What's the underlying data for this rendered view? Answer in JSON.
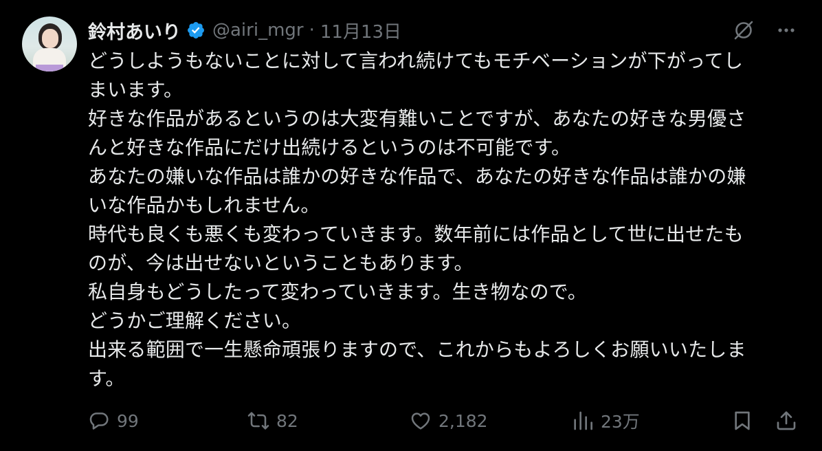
{
  "user": {
    "name": "鈴村あいり",
    "handle": "@airi_mgr",
    "separator": "·",
    "date": "11月13日"
  },
  "tweet": {
    "lines": [
      "どうしようもないことに対して言われ続けてもモチベーションが下がってし",
      "まいます。",
      "好きな作品があるというのは大変有難いことですが、あなたの好きな男優さ",
      "んと好きな作品にだけ出続けるというのは不可能です。",
      "あなたの嫌いな作品は誰かの好きな作品で、あなたの好きな作品は誰かの嫌",
      "いな作品かもしれません。",
      "時代も良くも悪くも変わっていきます。数年前には作品として世に出せたも",
      "のが、今は出せないということもあります。",
      "私自身もどうしたって変わっていきます。生き物なので。",
      "どうかご理解ください。",
      "出来る範囲で一生懸命頑張りますので、これからもよろしくお願いいたしま",
      "す。"
    ]
  },
  "stats": {
    "replies": "99",
    "reposts": "82",
    "likes": "2,182",
    "views": "23万"
  },
  "icons": {
    "verified": "verified-badge-icon",
    "grok": "grok-icon",
    "more": "more-icon",
    "reply": "reply-icon",
    "repost": "repost-icon",
    "like": "heart-icon",
    "views": "views-icon",
    "bookmark": "bookmark-icon",
    "share": "share-icon"
  },
  "colors": {
    "background": "#000000",
    "text": "#e7e9ea",
    "muted": "#71767b",
    "verified": "#1d9bf0"
  }
}
